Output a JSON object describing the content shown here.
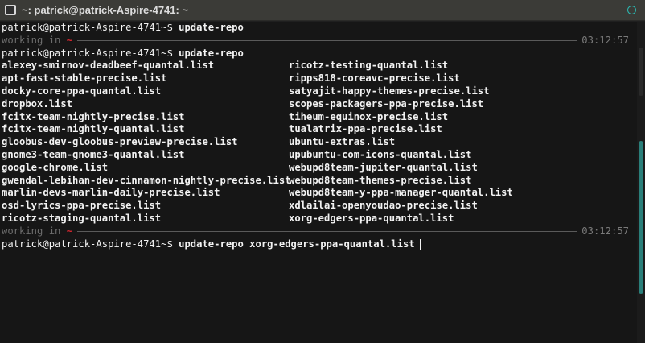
{
  "window": {
    "title": "~: patrick@patrick-Aspire-4741: ~"
  },
  "terminal": {
    "prompt_user": "patrick@patrick-Aspire-4741~$ ",
    "cmd1": "update-repo",
    "status1_text": "working in ",
    "status1_tilde": "~",
    "status1_time": "03:12:57",
    "cmd2": "update-repo",
    "list_left": [
      "alexey-smirnov-deadbeef-quantal.list",
      "apt-fast-stable-precise.list",
      "docky-core-ppa-quantal.list",
      "dropbox.list",
      "fcitx-team-nightly-precise.list",
      "fcitx-team-nightly-quantal.list",
      "gloobus-dev-gloobus-preview-precise.list",
      "gnome3-team-gnome3-quantal.list",
      "google-chrome.list",
      "gwendal-lebihan-dev-cinnamon-nightly-precise.list",
      "marlin-devs-marlin-daily-precise.list",
      "osd-lyrics-ppa-precise.list",
      "ricotz-staging-quantal.list"
    ],
    "list_right": [
      "ricotz-testing-quantal.list",
      "ripps818-coreavc-precise.list",
      "satyajit-happy-themes-precise.list",
      "scopes-packagers-ppa-precise.list",
      "tiheum-equinox-precise.list",
      "tualatrix-ppa-precise.list",
      "ubuntu-extras.list",
      "upubuntu-com-icons-quantal.list",
      "webupd8team-jupiter-quantal.list",
      "webupd8team-themes-precise.list",
      "webupd8team-y-ppa-manager-quantal.list",
      "xdlailai-openyoudao-precise.list",
      "xorg-edgers-ppa-quantal.list"
    ],
    "status2_text": "working in ",
    "status2_tilde": "~",
    "status2_time": "03:12:57",
    "cmd3": "update-repo xorg-edgers-ppa-quantal.list"
  },
  "colors": {
    "accent": "#2bb7b0",
    "tilde": "#d3262e",
    "background": "#161616"
  }
}
